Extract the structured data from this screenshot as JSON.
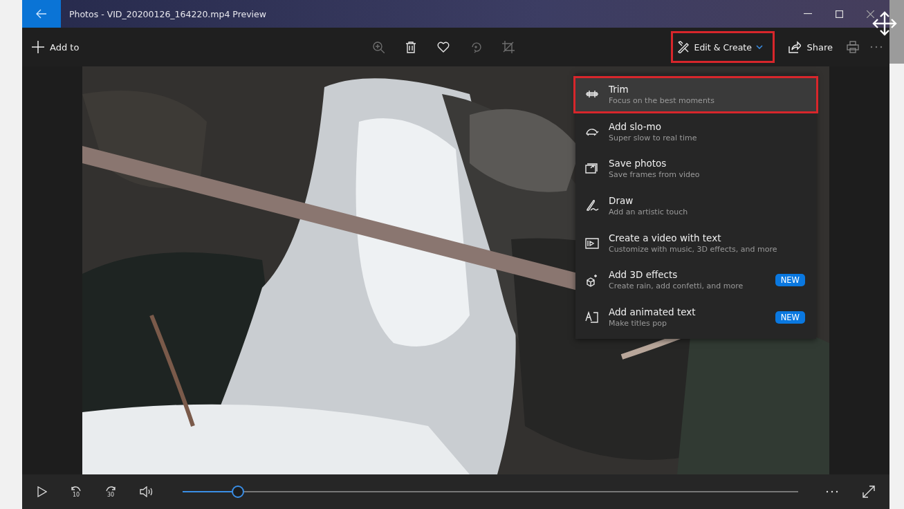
{
  "window": {
    "title": "Photos - VID_20200126_164220.mp4 Preview"
  },
  "toolbar": {
    "add_label": "Add to",
    "icons": [
      {
        "disabled": true
      },
      {
        "disabled": false
      },
      {
        "disabled": false
      },
      {
        "disabled": true
      },
      {
        "disabled": true
      }
    ],
    "edit_button": {
      "label": "Edit & Create",
      "highlighted": true,
      "expanded": true
    },
    "share_label": "Share"
  },
  "menu": [
    {
      "title": "Trim",
      "subtitle": "Focus on the best moments",
      "highlighted": true
    },
    {
      "title": "Add slo-mo",
      "subtitle": "Super slow to real time",
      "highlighted": false
    },
    {
      "title": "Save photos",
      "subtitle": "Save frames from video",
      "highlighted": false
    },
    {
      "title": "Draw",
      "subtitle": "Add an artistic touch",
      "highlighted": false
    },
    {
      "title": "Create a video with text",
      "subtitle": "Customize with music, 3D effects, and more",
      "highlighted": false
    },
    {
      "title": "Add 3D effects",
      "subtitle": "Create rain, add confetti, and more",
      "badge": "NEW",
      "highlighted": false
    },
    {
      "title": "Add animated text",
      "subtitle": "Make titles pop",
      "badge": "NEW",
      "highlighted": false
    }
  ],
  "player": {
    "skip_back": "10",
    "skip_forward": "30",
    "seek": {
      "level": 0.09
    }
  }
}
